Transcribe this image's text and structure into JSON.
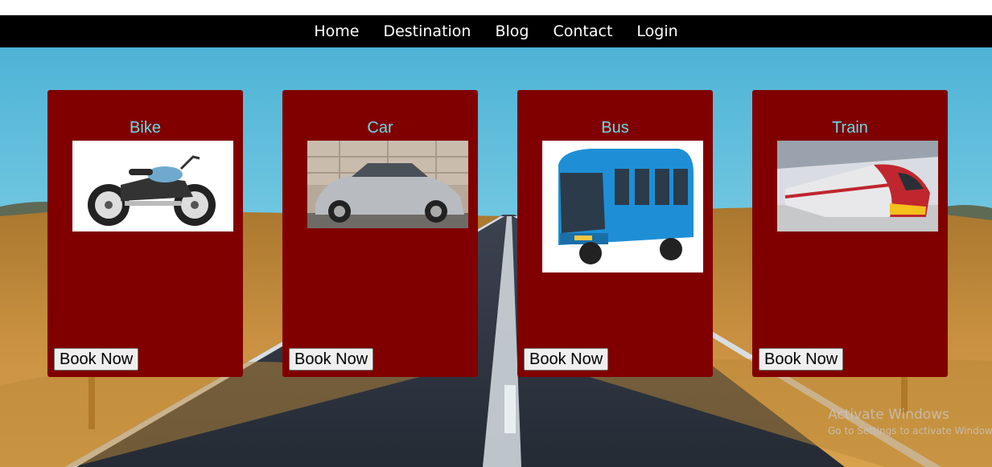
{
  "nav": {
    "items": [
      {
        "label": "Home"
      },
      {
        "label": "Destination"
      },
      {
        "label": "Blog"
      },
      {
        "label": "Contact"
      },
      {
        "label": "Login"
      }
    ]
  },
  "cards": [
    {
      "title": "Bike",
      "button": "Book Now",
      "image": "motorcycle-photo"
    },
    {
      "title": "Car",
      "button": "Book Now",
      "image": "car-photo"
    },
    {
      "title": "Bus",
      "button": "Book Now",
      "image": "bus-photo"
    },
    {
      "title": "Train",
      "button": "Book Now",
      "image": "train-photo"
    }
  ],
  "watermark": {
    "line1": "Activate Windows",
    "line2": "Go to Settings to activate Windows."
  },
  "colors": {
    "navbar": "#000000",
    "card": "#800000",
    "card_title": "#67d9e6",
    "sky": "#6cc6dd",
    "road": "#2f3744"
  }
}
